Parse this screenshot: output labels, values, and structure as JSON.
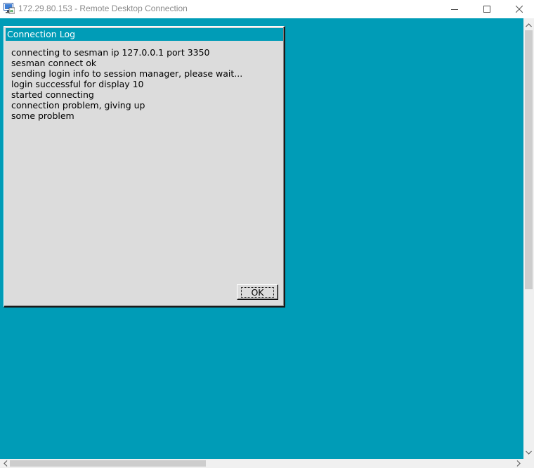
{
  "window": {
    "title": "172.29.80.153 - Remote Desktop Connection",
    "icon": "remote-desktop-icon",
    "controls": [
      "minimize-icon",
      "maximize-icon",
      "close-icon"
    ]
  },
  "desktop": {
    "background_color": "#009cb7"
  },
  "dialog": {
    "title": "Connection Log",
    "log_lines": [
      "connecting to sesman ip 127.0.0.1 port 3350",
      "sesman connect ok",
      "sending login info to session manager, please wait...",
      "login successful for display 10",
      "started connecting",
      "connection problem, giving up",
      "some problem"
    ],
    "ok_label": "OK"
  }
}
